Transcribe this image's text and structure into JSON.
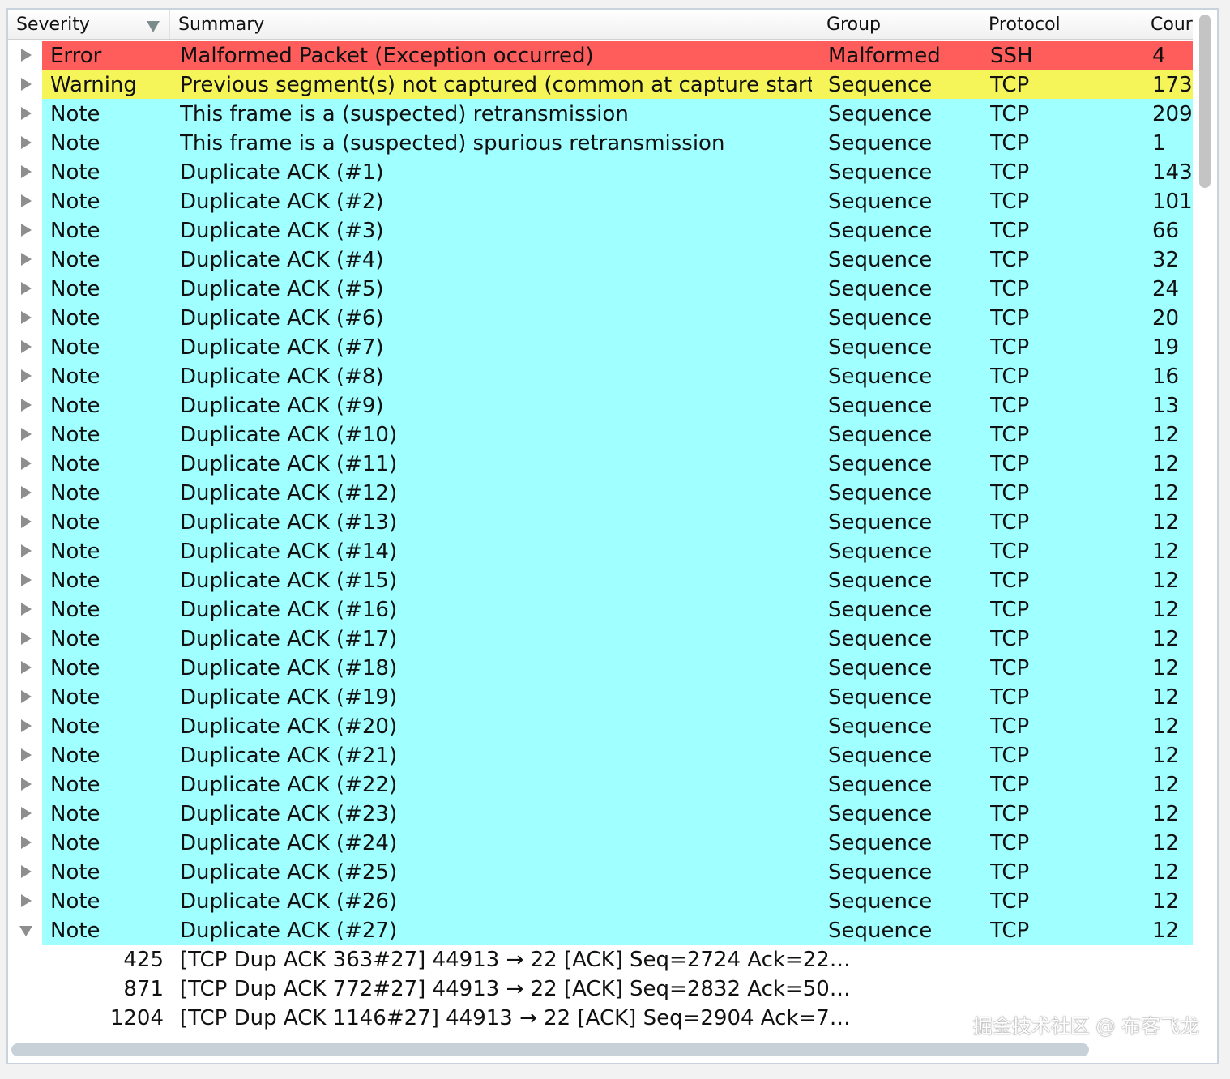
{
  "headers": {
    "severity": "Severity",
    "summary": "Summary",
    "group": "Group",
    "protocol": "Protocol",
    "count": "Cour"
  },
  "colors": {
    "error": "#ff5c5c",
    "warning": "#f5f55a",
    "note": "#a0ffff"
  },
  "rows": [
    {
      "severity": "Error",
      "summary": "Malformed Packet (Exception occurred)",
      "group": "Malformed",
      "protocol": "SSH",
      "count": "4",
      "type": "error"
    },
    {
      "severity": "Warning",
      "summary": "Previous segment(s) not captured (common at capture start)",
      "group": "Sequence",
      "protocol": "TCP",
      "count": "173",
      "type": "warning"
    },
    {
      "severity": "Note",
      "summary": "This frame is a (suspected) retransmission",
      "group": "Sequence",
      "protocol": "TCP",
      "count": "209",
      "type": "note"
    },
    {
      "severity": "Note",
      "summary": "This frame is a (suspected) spurious retransmission",
      "group": "Sequence",
      "protocol": "TCP",
      "count": "1",
      "type": "note"
    },
    {
      "severity": "Note",
      "summary": "Duplicate ACK (#1)",
      "group": "Sequence",
      "protocol": "TCP",
      "count": "143",
      "type": "note"
    },
    {
      "severity": "Note",
      "summary": "Duplicate ACK (#2)",
      "group": "Sequence",
      "protocol": "TCP",
      "count": "101",
      "type": "note"
    },
    {
      "severity": "Note",
      "summary": "Duplicate ACK (#3)",
      "group": "Sequence",
      "protocol": "TCP",
      "count": "66",
      "type": "note"
    },
    {
      "severity": "Note",
      "summary": "Duplicate ACK (#4)",
      "group": "Sequence",
      "protocol": "TCP",
      "count": "32",
      "type": "note"
    },
    {
      "severity": "Note",
      "summary": "Duplicate ACK (#5)",
      "group": "Sequence",
      "protocol": "TCP",
      "count": "24",
      "type": "note"
    },
    {
      "severity": "Note",
      "summary": "Duplicate ACK (#6)",
      "group": "Sequence",
      "protocol": "TCP",
      "count": "20",
      "type": "note"
    },
    {
      "severity": "Note",
      "summary": "Duplicate ACK (#7)",
      "group": "Sequence",
      "protocol": "TCP",
      "count": "19",
      "type": "note"
    },
    {
      "severity": "Note",
      "summary": "Duplicate ACK (#8)",
      "group": "Sequence",
      "protocol": "TCP",
      "count": "16",
      "type": "note"
    },
    {
      "severity": "Note",
      "summary": "Duplicate ACK (#9)",
      "group": "Sequence",
      "protocol": "TCP",
      "count": "13",
      "type": "note"
    },
    {
      "severity": "Note",
      "summary": "Duplicate ACK (#10)",
      "group": "Sequence",
      "protocol": "TCP",
      "count": "12",
      "type": "note"
    },
    {
      "severity": "Note",
      "summary": "Duplicate ACK (#11)",
      "group": "Sequence",
      "protocol": "TCP",
      "count": "12",
      "type": "note"
    },
    {
      "severity": "Note",
      "summary": "Duplicate ACK (#12)",
      "group": "Sequence",
      "protocol": "TCP",
      "count": "12",
      "type": "note"
    },
    {
      "severity": "Note",
      "summary": "Duplicate ACK (#13)",
      "group": "Sequence",
      "protocol": "TCP",
      "count": "12",
      "type": "note"
    },
    {
      "severity": "Note",
      "summary": "Duplicate ACK (#14)",
      "group": "Sequence",
      "protocol": "TCP",
      "count": "12",
      "type": "note"
    },
    {
      "severity": "Note",
      "summary": "Duplicate ACK (#15)",
      "group": "Sequence",
      "protocol": "TCP",
      "count": "12",
      "type": "note"
    },
    {
      "severity": "Note",
      "summary": "Duplicate ACK (#16)",
      "group": "Sequence",
      "protocol": "TCP",
      "count": "12",
      "type": "note"
    },
    {
      "severity": "Note",
      "summary": "Duplicate ACK (#17)",
      "group": "Sequence",
      "protocol": "TCP",
      "count": "12",
      "type": "note"
    },
    {
      "severity": "Note",
      "summary": "Duplicate ACK (#18)",
      "group": "Sequence",
      "protocol": "TCP",
      "count": "12",
      "type": "note"
    },
    {
      "severity": "Note",
      "summary": "Duplicate ACK (#19)",
      "group": "Sequence",
      "protocol": "TCP",
      "count": "12",
      "type": "note"
    },
    {
      "severity": "Note",
      "summary": "Duplicate ACK (#20)",
      "group": "Sequence",
      "protocol": "TCP",
      "count": "12",
      "type": "note"
    },
    {
      "severity": "Note",
      "summary": "Duplicate ACK (#21)",
      "group": "Sequence",
      "protocol": "TCP",
      "count": "12",
      "type": "note"
    },
    {
      "severity": "Note",
      "summary": "Duplicate ACK (#22)",
      "group": "Sequence",
      "protocol": "TCP",
      "count": "12",
      "type": "note"
    },
    {
      "severity": "Note",
      "summary": "Duplicate ACK (#23)",
      "group": "Sequence",
      "protocol": "TCP",
      "count": "12",
      "type": "note"
    },
    {
      "severity": "Note",
      "summary": "Duplicate ACK (#24)",
      "group": "Sequence",
      "protocol": "TCP",
      "count": "12",
      "type": "note"
    },
    {
      "severity": "Note",
      "summary": "Duplicate ACK (#25)",
      "group": "Sequence",
      "protocol": "TCP",
      "count": "12",
      "type": "note"
    },
    {
      "severity": "Note",
      "summary": "Duplicate ACK (#26)",
      "group": "Sequence",
      "protocol": "TCP",
      "count": "12",
      "type": "note"
    },
    {
      "severity": "Note",
      "summary": "Duplicate ACK (#27)",
      "group": "Sequence",
      "protocol": "TCP",
      "count": "12",
      "type": "note",
      "expanded": true
    }
  ],
  "children": [
    {
      "packet": "425",
      "info": "[TCP Dup ACK 363#27] 44913 → 22 [ACK] Seq=2724 Ack=22…"
    },
    {
      "packet": "871",
      "info": "[TCP Dup ACK 772#27] 44913 → 22 [ACK] Seq=2832 Ack=50…"
    },
    {
      "packet": "1204",
      "info": "[TCP Dup ACK 1146#27] 44913 → 22 [ACK] Seq=2904 Ack=7…"
    }
  ],
  "watermark": "掘金技术社区 @ 布客飞龙"
}
